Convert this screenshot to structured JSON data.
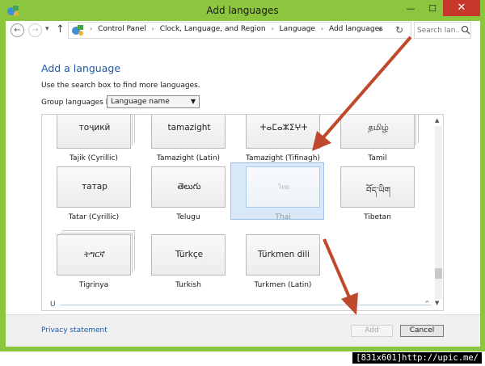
{
  "window": {
    "title": "Add languages",
    "controls": {
      "minimize": "—",
      "maximize": "☐",
      "close": "✕"
    }
  },
  "nav": {
    "back": "←",
    "forward": "→",
    "recent": "▾",
    "up": "↑",
    "breadcrumbs": [
      "Control Panel",
      "Clock, Language, and Region",
      "Language",
      "Add languages"
    ],
    "breadcrumb_sep": "›",
    "dropdown": "▾",
    "refresh": "↻",
    "search_placeholder": "Search lan..."
  },
  "content": {
    "heading": "Add a language",
    "hint": "Use the search box to find more languages.",
    "group_label": "Group languages by:",
    "group_value": "Language name",
    "group_arrow": "▼"
  },
  "languages": [
    {
      "native": "тоҷикӣ",
      "name": "Tajik (Cyrillic)",
      "selected": false
    },
    {
      "native": "tamazight",
      "name": "Tamazight (Latin)",
      "selected": false
    },
    {
      "native": "ⵜⴰⵎⴰⵣⵉⵖⵜ",
      "name": "Tamazight (Tifinagh)",
      "selected": false
    },
    {
      "native": "தமிழ்",
      "name": "Tamil",
      "selected": false
    },
    {
      "native": "татар",
      "name": "Tatar (Cyrillic)",
      "selected": false
    },
    {
      "native": "తెలుగు",
      "name": "Telugu",
      "selected": false
    },
    {
      "native": "ไทย",
      "name": "Thai",
      "selected": true
    },
    {
      "native": "བོད་ཡིག",
      "name": "Tibetan",
      "selected": false
    },
    {
      "native": "ትግርኛ",
      "name": "Tigrinya",
      "selected": false
    },
    {
      "native": "Türkçe",
      "name": "Turkish",
      "selected": false
    },
    {
      "native": "Türkmen dili",
      "name": "Turkmen (Latin)",
      "selected": false
    }
  ],
  "group_letter": "U",
  "scroll": {
    "up": "▲",
    "down": "▼",
    "collapse": "^"
  },
  "footer": {
    "privacy": "Privacy statement",
    "add": "Add",
    "cancel": "Cancel"
  },
  "watermark": "[831x601]http://upic.me/",
  "colors": {
    "frame": "#8cc63f",
    "close": "#c7372c",
    "link": "#1e5aa8",
    "arrow": "#c0492d"
  }
}
